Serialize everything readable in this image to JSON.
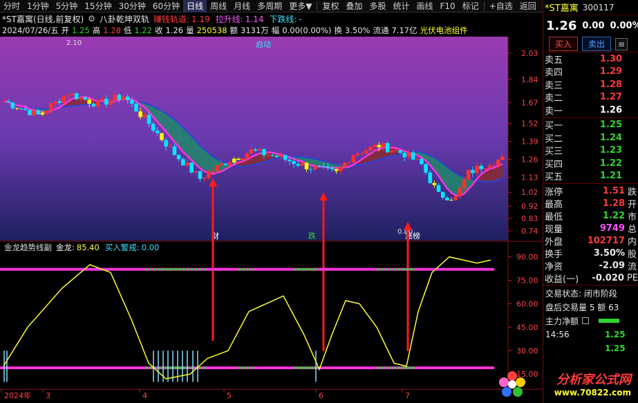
{
  "toolbar": {
    "items": [
      "分时",
      "1分钟",
      "5分钟",
      "15分钟",
      "30分钟",
      "60分钟",
      "日线",
      "周线",
      "月线",
      "多周期",
      "更多▼",
      "复权",
      "叠加",
      "多股",
      "统计",
      "画线",
      "F10",
      "标记",
      "+自选",
      "返回"
    ],
    "active": "日线"
  },
  "header": {
    "stock": "*ST嘉寓(日线,前复权)",
    "indicator": "八卦乾坤双轨",
    "lines": [
      {
        "label": "赚钱轨道:",
        "value": "1.19",
        "color": "#ff3b3b"
      },
      {
        "label": "拉升线:",
        "value": "1.14",
        "color": "#ff55ff"
      },
      {
        "label": "下跌线:",
        "value": "-",
        "color": "#40e0ff"
      }
    ]
  },
  "quote": {
    "date": "2024/07/26/五",
    "open_l": "开",
    "open": "1.25",
    "high_l": "高",
    "high": "1.28",
    "low_l": "低",
    "low": "1.22",
    "close_l": "收",
    "close": "1.26",
    "vol_l": "量",
    "vol": "250538",
    "amt_l": "额",
    "amt": "3131万",
    "range_l": "幅",
    "range": "0.00(0.00%)",
    "turn_l": "换",
    "turn": "3.50%",
    "float_l": "流通",
    "float": "7.17亿",
    "sector": "光伏电池组件"
  },
  "main": {
    "label_top": "启动",
    "label_peak": "2.10",
    "label_min": "0.80",
    "marks": [
      "财",
      "跌",
      "涨榜"
    ],
    "ticks": [
      "2.03",
      "1.84",
      "1.67",
      "1.52",
      "1.39",
      "1.26",
      "1.13",
      "1.02",
      "0.92",
      "0.83",
      "0.74"
    ],
    "band_colors": {
      "green": "#1e8a68",
      "red": "#8a2a30",
      "pink": "#ff33dd",
      "blue": "#2246e0"
    }
  },
  "sub": {
    "title": "金龙趋势线副",
    "gold_l": "金龙:",
    "gold": "85.40",
    "warn_l": "买入警戒:",
    "warn": "0.00",
    "ticks": [
      "90.00",
      "75.00",
      "60.00",
      "45.00",
      "30.00",
      "15.00"
    ]
  },
  "xaxis": {
    "labels": [
      "2024年",
      "3",
      "4",
      "5",
      "6",
      "7"
    ]
  },
  "side": {
    "name": "*ST嘉寓",
    "code": "300117",
    "price": "1.26",
    "chg": "0.00",
    "pct": "0.00%",
    "buy": "买入",
    "sell": "卖出",
    "more": "≡",
    "asks": [
      {
        "l": "卖五",
        "p": "1.30"
      },
      {
        "l": "卖四",
        "p": "1.29"
      },
      {
        "l": "卖三",
        "p": "1.28"
      },
      {
        "l": "卖二",
        "p": "1.27"
      },
      {
        "l": "卖一",
        "p": "1.26"
      }
    ],
    "bids": [
      {
        "l": "买一",
        "p": "1.25"
      },
      {
        "l": "买二",
        "p": "1.24"
      },
      {
        "l": "买三",
        "p": "1.23"
      },
      {
        "l": "买四",
        "p": "1.22"
      },
      {
        "l": "买五",
        "p": "1.21"
      }
    ],
    "stats": [
      {
        "l": "涨停",
        "v": "1.51",
        "t": "跌",
        "c": "#ff3b3b"
      },
      {
        "l": "最高",
        "v": "1.28",
        "t": "开",
        "c": "#ff3b3b"
      },
      {
        "l": "最低",
        "v": "1.22",
        "t": "市",
        "c": "#2fd62f"
      },
      {
        "l": "现量",
        "v": "9749",
        "t": "总",
        "c": "#ff55ff"
      },
      {
        "l": "外盘",
        "v": "102717",
        "t": "内",
        "c": "#ff3b3b"
      },
      {
        "l": "换手",
        "v": "3.50%",
        "t": "股",
        "c": "#e8e8e8"
      },
      {
        "l": "净资",
        "v": "-2.09",
        "t": "流",
        "c": "#e8e8e8"
      },
      {
        "l": "收益(一)",
        "v": "-0.020",
        "t": "PE",
        "c": "#e8e8e8"
      }
    ],
    "status1": "交易状态: 闭市阶段",
    "status2": "盘后交易量 5 额 63",
    "net": "主力净额",
    "ticks": [
      {
        "t": "14:56",
        "v": "1.25"
      },
      {
        "t": "",
        "v": "1.25"
      }
    ]
  },
  "logo": {
    "title": "分析家公式网",
    "url": "www.70822.com"
  }
}
